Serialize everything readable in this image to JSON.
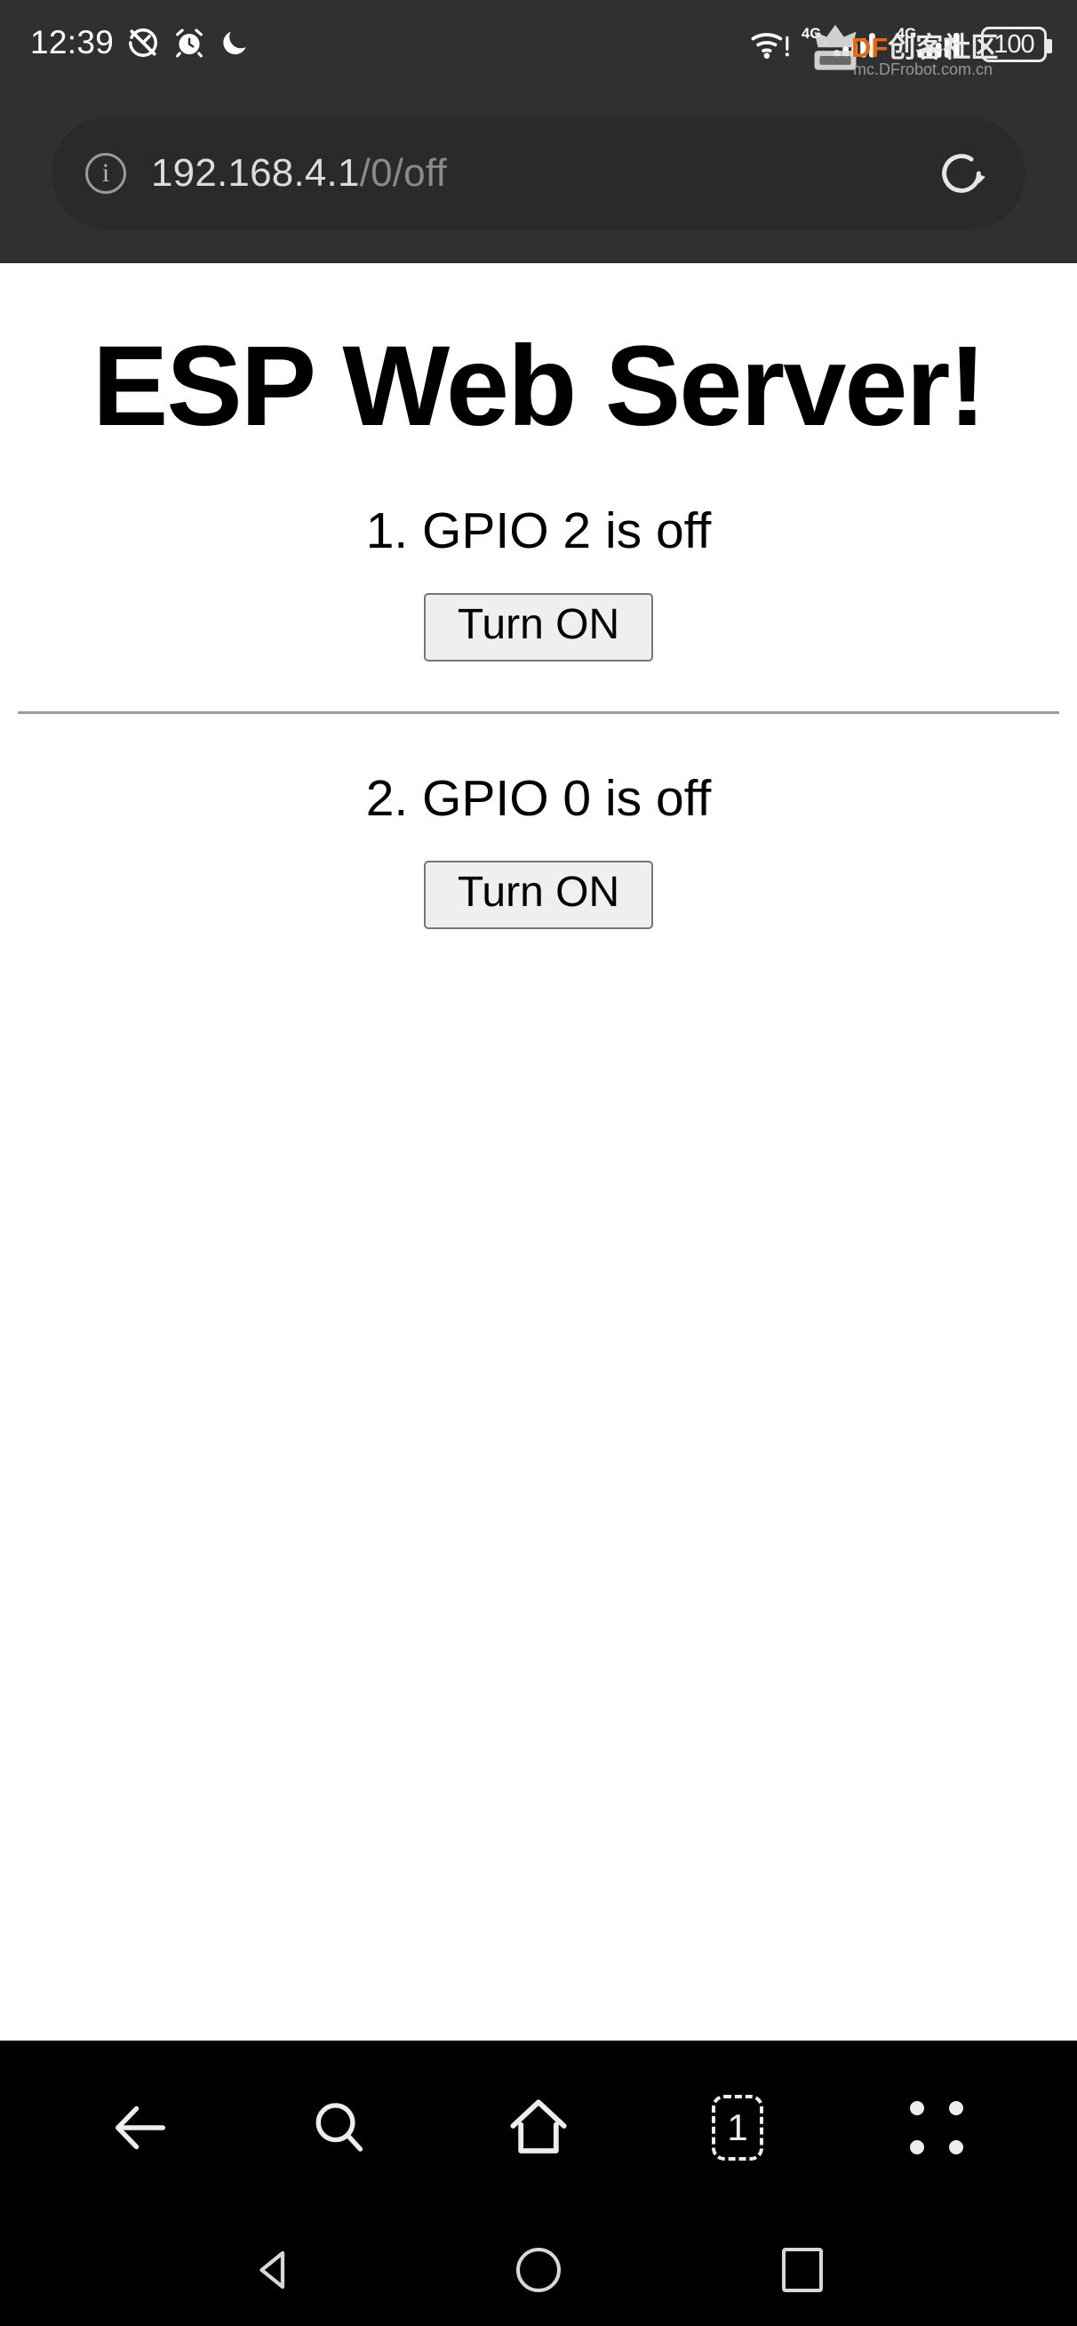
{
  "status_bar": {
    "time": "12:39",
    "icons": [
      "mute-speedometer-icon",
      "alarm-clock-icon",
      "do-not-disturb-moon-icon"
    ],
    "wifi": "wifi-alert-icon",
    "network_1_label": "4G",
    "network_2_label": "4G",
    "battery_percent": "100",
    "watermark": {
      "brand_prefix": "DF",
      "brand_suffix": "创客社区",
      "url": "mc.DFrobot.com.cn"
    }
  },
  "browser": {
    "url_host": "192.168.4.1",
    "url_path": "/0/off",
    "info_glyph": "i",
    "reload_label": "reload-icon",
    "toolbar": {
      "back_label": "back-arrow-icon",
      "search_label": "search-icon",
      "home_label": "home-icon",
      "tab_count": "1",
      "menu_label": "menu-dots-icon"
    }
  },
  "page": {
    "title": "ESP Web Server!",
    "sections": [
      {
        "label": "1. GPIO 2 is off",
        "button": "Turn ON"
      },
      {
        "label": "2. GPIO 0 is off",
        "button": "Turn ON"
      }
    ]
  },
  "android_nav": {
    "back": "back-triangle-icon",
    "home": "home-circle-icon",
    "recents": "recents-square-icon"
  },
  "colors": {
    "chrome_bg": "#303031",
    "urlbar_bg": "#2a2a2b",
    "page_bg": "#ffffff",
    "toolbar_bg": "#000000",
    "button_bg": "#efefef",
    "button_border": "#767676",
    "watermark_accent": "#e8690b"
  }
}
